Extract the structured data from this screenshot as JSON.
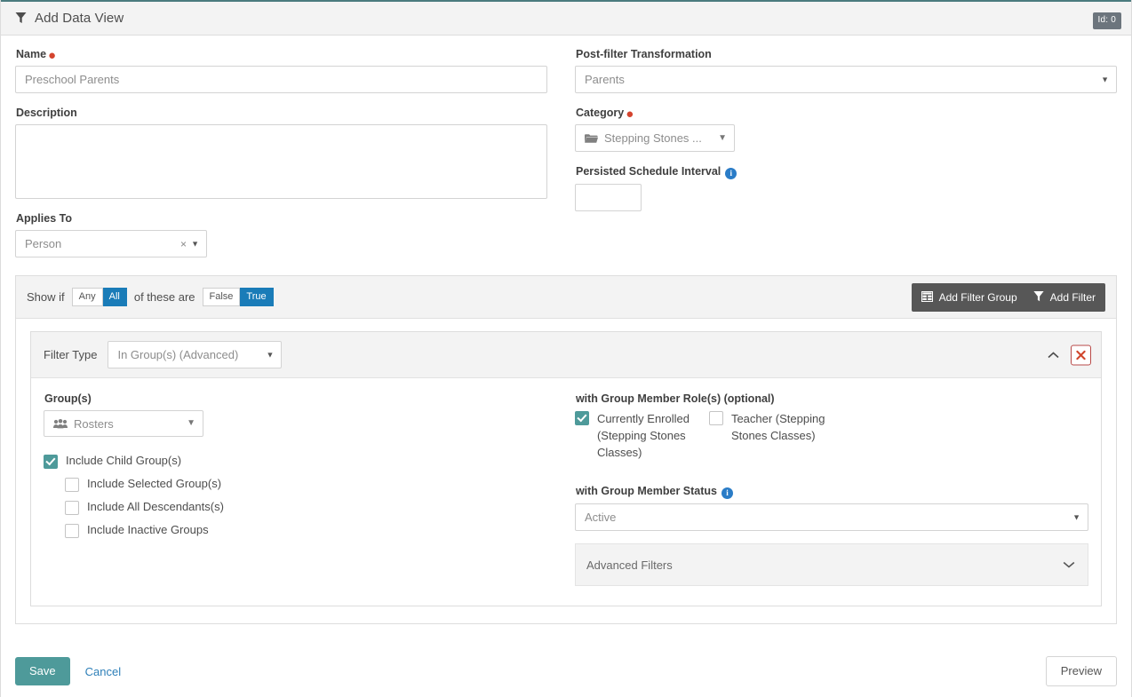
{
  "header": {
    "title": "Add Data View",
    "icon": "funnel-icon",
    "id_badge": "Id: 0"
  },
  "form": {
    "name": {
      "label": "Name",
      "required": true,
      "value": "",
      "placeholder": "Preschool Parents"
    },
    "description": {
      "label": "Description",
      "value": "",
      "placeholder": ""
    },
    "applies_to": {
      "label": "Applies To",
      "value": "Person",
      "clear_glyph": "×"
    },
    "post_filter_transformation": {
      "label": "Post-filter Transformation",
      "value": "Parents"
    },
    "category": {
      "label": "Category",
      "required": true,
      "value": "Stepping Stones ...",
      "icon": "folder-icon"
    },
    "persisted_schedule_interval": {
      "label": "Persisted Schedule Interval",
      "value": "",
      "info": "i"
    }
  },
  "filter_toolbar": {
    "show_if_prefix": "Show if",
    "middle_text": "of these are",
    "match_options": [
      "Any",
      "All"
    ],
    "match_selected": "All",
    "truth_options": [
      "False",
      "True"
    ],
    "truth_selected": "True",
    "add_filter_group_label": "Add Filter Group",
    "add_filter_label": "Add Filter"
  },
  "filter_card": {
    "filter_type_label": "Filter Type",
    "filter_type_value": "In Group(s) (Advanced)",
    "collapse_icon": "chevron-up-icon",
    "delete_glyph": "✕",
    "groups": {
      "label": "Group(s)",
      "value": "Rosters",
      "icon": "users-group-icon",
      "include_child_groups": {
        "label": "Include Child Group(s)",
        "checked": true
      },
      "sub_options": [
        {
          "label": "Include Selected Group(s)",
          "checked": false
        },
        {
          "label": "Include All Descendants(s)",
          "checked": false
        },
        {
          "label": "Include Inactive Groups",
          "checked": false
        }
      ]
    },
    "roles": {
      "label": "with Group Member Role(s) (optional)",
      "items": [
        {
          "label": "Currently Enrolled (Stepping Stones Classes)",
          "checked": true
        },
        {
          "label": "Teacher (Stepping Stones Classes)",
          "checked": false
        }
      ]
    },
    "member_status": {
      "label": "with Group Member Status",
      "info": "i",
      "value": "Active"
    },
    "advanced_filters": {
      "label": "Advanced Filters",
      "chevron": "chevron-down-icon"
    }
  },
  "footer": {
    "save_label": "Save",
    "cancel_label": "Cancel",
    "preview_label": "Preview"
  },
  "colors": {
    "accent_teal": "#4e9a9a",
    "toggle_blue": "#1a7cb8",
    "required_red": "#d4442e",
    "delete_red": "#b94a48",
    "toolbar_dark": "#575757",
    "info_blue": "#2a7cc7"
  }
}
